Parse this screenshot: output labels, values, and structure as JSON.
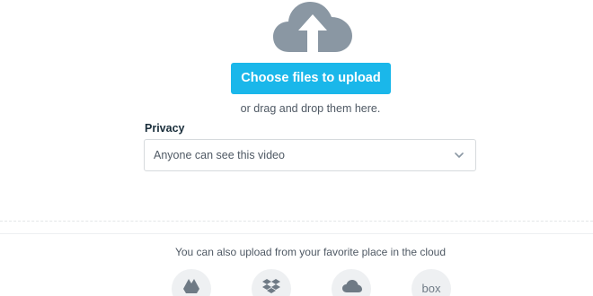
{
  "upload": {
    "icon": "cloud-upload-icon",
    "button_label": "Choose files to upload",
    "drag_text": "or drag and drop them here."
  },
  "privacy": {
    "label": "Privacy",
    "selected": "Anyone can see this video",
    "icon": "chevron-down-icon"
  },
  "cloud": {
    "text": "You can also upload from your favorite place in the cloud",
    "providers": [
      {
        "name": "google-drive",
        "icon": "google-drive-icon"
      },
      {
        "name": "dropbox",
        "icon": "dropbox-icon"
      },
      {
        "name": "onedrive",
        "icon": "onedrive-icon"
      },
      {
        "name": "box",
        "icon": "box-icon",
        "label": "box"
      }
    ]
  },
  "colors": {
    "accent": "#1ab7ea",
    "icon_gray": "#8a97a3"
  }
}
